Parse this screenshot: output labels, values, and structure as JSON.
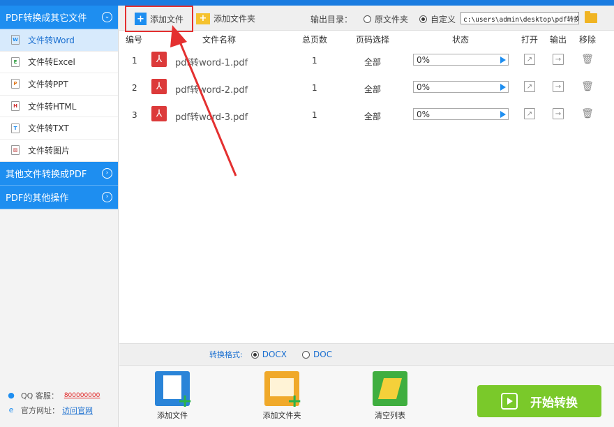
{
  "sidebar": {
    "sections": [
      {
        "label": "PDF转换成其它文件",
        "expanded": true
      },
      {
        "label": "其他文件转换成PDF",
        "expanded": false
      },
      {
        "label": "PDF的其他操作",
        "expanded": false
      }
    ],
    "items": [
      {
        "label": "文件转Word",
        "icon": "W"
      },
      {
        "label": "文件转Excel",
        "icon": "E"
      },
      {
        "label": "文件转PPT",
        "icon": "P"
      },
      {
        "label": "文件转HTML",
        "icon": "H"
      },
      {
        "label": "文件转TXT",
        "icon": "T"
      },
      {
        "label": "文件转图片",
        "icon": "▨"
      }
    ],
    "footer": {
      "qq_label": "QQ 客服：",
      "qq_value": "800000000",
      "site_label": "官方网址：",
      "site_link": "访问官网"
    }
  },
  "toolbar": {
    "add_file": "添加文件",
    "add_folder": "添加文件夹",
    "output_label": "输出目录：",
    "opt_original": "原文件夹",
    "opt_custom": "自定义",
    "path": "c:\\users\\admin\\desktop\\pdf转换"
  },
  "table": {
    "headers": [
      "编号",
      "文件名称",
      "总页数",
      "页码选择",
      "状态",
      "打开",
      "输出",
      "移除"
    ],
    "rows": [
      {
        "num": "1",
        "name": "pdf转word-1.pdf",
        "pages": "1",
        "range": "全部",
        "status": "0%"
      },
      {
        "num": "2",
        "name": "pdf转word-2.pdf",
        "pages": "1",
        "range": "全部",
        "status": "0%"
      },
      {
        "num": "3",
        "name": "pdf转word-3.pdf",
        "pages": "1",
        "range": "全部",
        "status": "0%"
      }
    ]
  },
  "format": {
    "label": "转换格式:",
    "opt1": "DOCX",
    "opt2": "DOC"
  },
  "bottom": {
    "add_file": "添加文件",
    "add_folder": "添加文件夹",
    "clear": "清空列表",
    "start": "开始转换"
  },
  "colors": {
    "accent": "#1e8ef0",
    "highlight": "#e43030",
    "start": "#7ac92a"
  }
}
